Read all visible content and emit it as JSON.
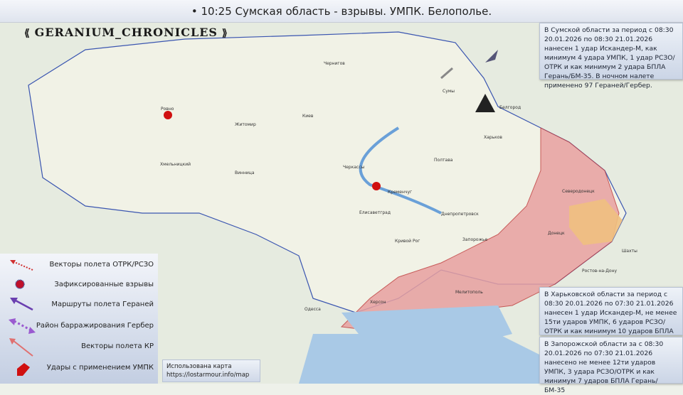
{
  "header": {
    "title": "• 10:25 Сумская область - взрывы. УМПК. Белополье."
  },
  "logo": {
    "text": "GERANIUM_CHRONICLES"
  },
  "colors": {
    "occupied": "#e8a0a0",
    "ukraine": "#eef0e4",
    "lpr": "#f0c080",
    "border": "#3a55b0",
    "legend_bg": "#d6deec"
  },
  "reports": [
    {
      "text": "В Сумской области за период с 08:30 20.01.2026 по 08:30 21.01.2026 нанесен 1 удар Искандер-М, как минимум 4 удара УМПК, 1 удар РСЗО/ОТРК и как минимум 2 удара БПЛА Герань/БМ-35. В ночном налете применено 97 Гераней/Гербер."
    },
    {
      "text": "В Харьковской области за период с 08:30 20.01.2026 по 07:30 21.01.2026 нанесен 1 удар Искандер-М, не менее 15ти ударов УМПК, 6 ударов РСЗО/ОТРК и как минимум 10 ударов БПЛА Герань/БМ-35."
    },
    {
      "text": "В Запорожской области за с 08:30 20.01.2026 по 07:30 21.01.2026 нанесено не менее 12ти ударов УМПК, 3 удара РСЗО/ОТРК и как минимум 7 ударов БПЛА Герань/БМ-35"
    }
  ],
  "legend": [
    {
      "icon": "dotted-red-arrow-icon",
      "label": "Векторы полета ОТРК/РСЗО"
    },
    {
      "icon": "explosion-icon",
      "label": "Зафиксированные взрывы"
    },
    {
      "icon": "purple-arrow-icon",
      "label": "Маршруты полета Гераней"
    },
    {
      "icon": "dotted-purple-double-arrow-icon",
      "label": "Район барражирования Гербер"
    },
    {
      "icon": "pink-arrow-icon",
      "label": "Векторы полета КР"
    },
    {
      "icon": "red-bomb-icon",
      "label": "Удары с применением УМПК"
    }
  ],
  "credit": {
    "line1": "Использована карта",
    "line2": "https://lostarmour.info/map"
  },
  "cities": [
    {
      "name": "Киев"
    },
    {
      "name": "Сумы"
    },
    {
      "name": "Белгород"
    },
    {
      "name": "Харьков"
    },
    {
      "name": "Полтава"
    },
    {
      "name": "Черкассы"
    },
    {
      "name": "Кременчуг"
    },
    {
      "name": "Винница"
    },
    {
      "name": "Житомир"
    },
    {
      "name": "Ровно"
    },
    {
      "name": "Хмельницкий"
    },
    {
      "name": "Елисаветград"
    },
    {
      "name": "Кривой Рог"
    },
    {
      "name": "Днепропетровск"
    },
    {
      "name": "Запорожье"
    },
    {
      "name": "Мелитополь"
    },
    {
      "name": "Одесса"
    },
    {
      "name": "Херсон"
    },
    {
      "name": "Донецк"
    },
    {
      "name": "Ростов-на-Дону"
    },
    {
      "name": "Шахты"
    },
    {
      "name": "Чернигов"
    },
    {
      "name": "Северодонецк"
    }
  ]
}
